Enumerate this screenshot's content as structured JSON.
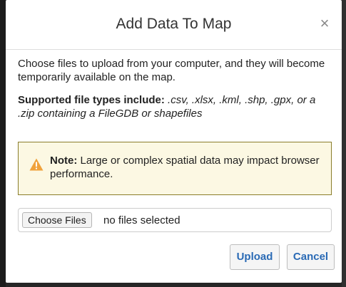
{
  "dialog": {
    "title": "Add Data To Map",
    "close_glyph": "×",
    "intro_text": "Choose files to upload from your computer, and they will become temporarily available on the map.",
    "supported_label": "Supported file types include:",
    "supported_types": " .csv, .xlsx, .kml, .shp, .gpx, or a .zip containing a FileGDB or shapefiles",
    "alert": {
      "icon": "warning-triangle-icon",
      "note_label": "Note:",
      "note_text": " Large or complex spatial data may impact browser performance.",
      "icon_color": "#f0a23b"
    },
    "file_input": {
      "button_label": "Choose Files",
      "status_text": "no files selected"
    },
    "buttons": {
      "upload_label": "Upload",
      "cancel_label": "Cancel"
    }
  }
}
